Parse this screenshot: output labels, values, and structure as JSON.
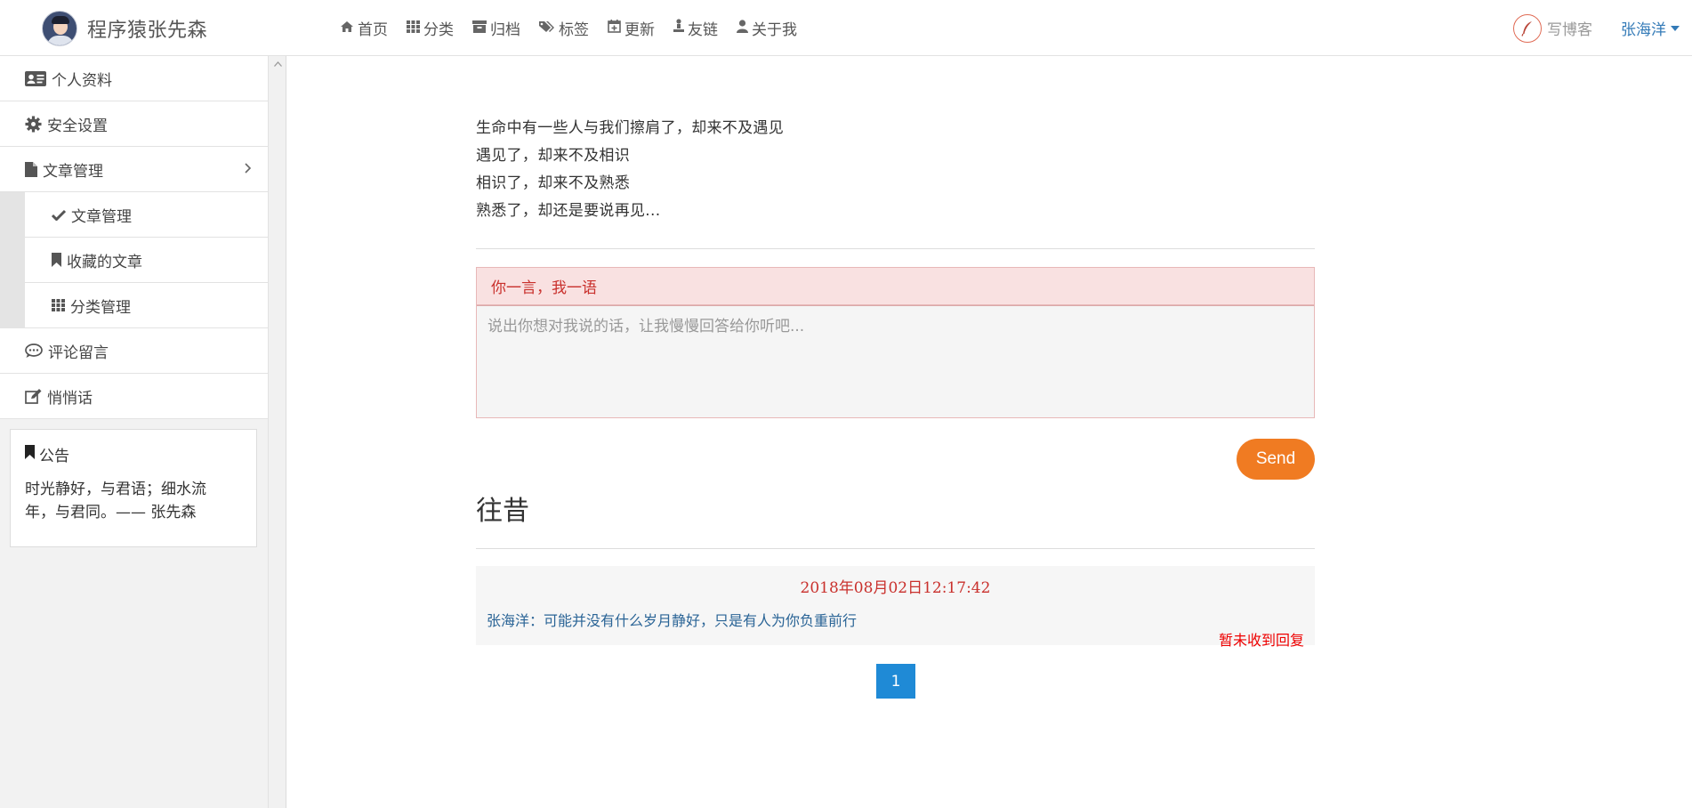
{
  "brand": {
    "title": "程序猿张先森"
  },
  "nav": {
    "items": [
      {
        "label": "首页",
        "icon": "home-icon"
      },
      {
        "label": "分类",
        "icon": "grid-icon"
      },
      {
        "label": "归档",
        "icon": "archive-icon"
      },
      {
        "label": "标签",
        "icon": "tags-icon"
      },
      {
        "label": "更新",
        "icon": "calendar-plus-icon"
      },
      {
        "label": "友链",
        "icon": "link-person-icon"
      },
      {
        "label": "关于我",
        "icon": "user-icon"
      }
    ],
    "write_blog": "写博客",
    "user": "张海洋"
  },
  "sidebar": {
    "items": [
      {
        "label": "个人资料",
        "icon": "id-card-icon"
      },
      {
        "label": "安全设置",
        "icon": "gear-icon"
      },
      {
        "label": "文章管理",
        "icon": "file-icon"
      }
    ],
    "sub_items": [
      {
        "label": "文章管理",
        "icon": "check-icon"
      },
      {
        "label": "收藏的文章",
        "icon": "bookmark-icon"
      },
      {
        "label": "分类管理",
        "icon": "grid-icon"
      }
    ],
    "items_after": [
      {
        "label": "评论留言",
        "icon": "comment-icon"
      },
      {
        "label": "悄悄话",
        "icon": "edit-icon"
      }
    ],
    "notice": {
      "title": "公告",
      "text_line1": "时光静好，与君语；细水流",
      "text_line2": "年，与君同。—— 张先森"
    }
  },
  "main": {
    "poem": [
      "生命中有一些人与我们擦肩了，却来不及遇见",
      "遇见了，却来不及相识",
      "相识了，却来不及熟悉",
      "熟悉了，却还是要说再见..."
    ],
    "message": {
      "header": "你一言，我一语",
      "placeholder": "说出你想对我说的话，让我慢慢回答给你听吧..."
    },
    "send_label": "Send",
    "past_title": "往昔",
    "comments": [
      {
        "time": "2018年08月02日12:17:42",
        "text": "张海洋：可能并没有什么岁月静好，只是有人为你负重前行",
        "reply_status": "暂未收到回复"
      }
    ],
    "pagination": {
      "current": "1"
    }
  },
  "colors": {
    "accent_orange": "#f07b22",
    "link_blue": "#337ab7",
    "alert_red": "#c9302c",
    "page_blue": "#1f8ad6"
  }
}
